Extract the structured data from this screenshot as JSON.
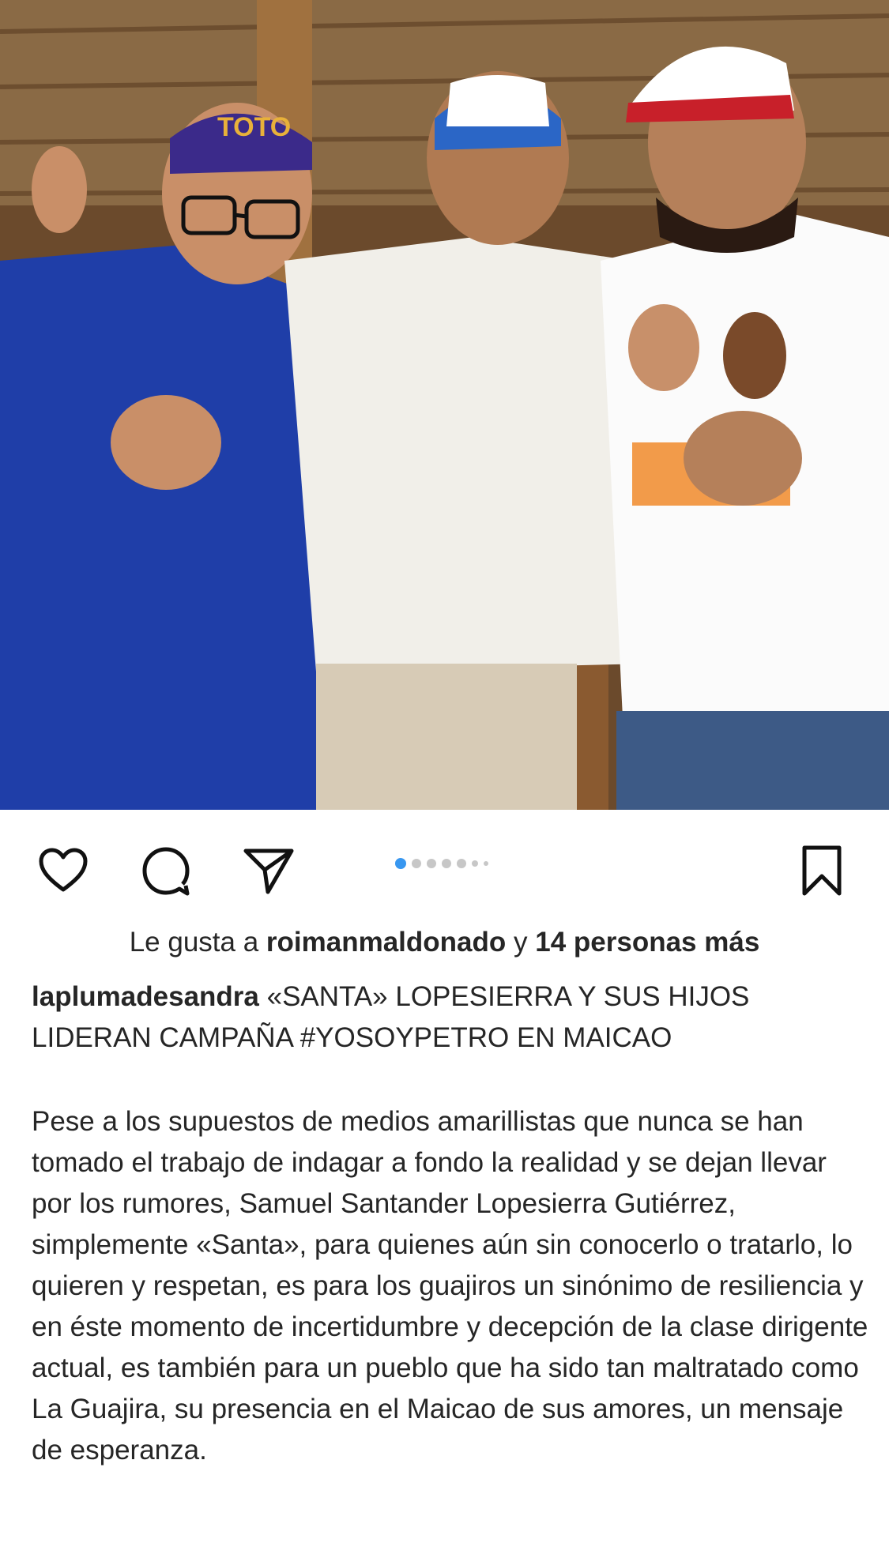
{
  "post": {
    "photo_alt": "Tres hombres sonriendo con gorras de campaña",
    "carousel": {
      "count": 7,
      "active_index": 1
    },
    "actions": {
      "like_icon": "heart-icon",
      "comment_icon": "comment-icon",
      "share_icon": "send-icon",
      "save_icon": "bookmark-icon"
    },
    "likes": {
      "prefix": "Le gusta a ",
      "user": "roimanmaldonado",
      "connector": " y ",
      "others": "14 personas más"
    },
    "caption": {
      "username": "laplumadesandra",
      "headline": " «SANTA» LOPESIERRA Y SUS HIJOS LIDERAN CAMPAÑA #YOSOYPETRO EN MAICAO",
      "body": "Pese a los supuestos de medios amarillistas que nunca se han tomado el trabajo de indagar a fondo la realidad y se dejan llevar por los rumores, Samuel Santander Lopesierra Gutiérrez, simplemente «Santa», para quienes aún sin conocerlo o tratarlo, lo quieren y respetan, es para los guajiros un sinónimo de resiliencia y en éste momento de incertidumbre y decepción de la clase dirigente actual, es también para un pueblo que ha sido tan maltratado como La Guajira, su presencia en el Maicao de sus amores,  un mensaje de esperanza."
    },
    "photo_text": {
      "cap_left": "TOTO"
    }
  }
}
